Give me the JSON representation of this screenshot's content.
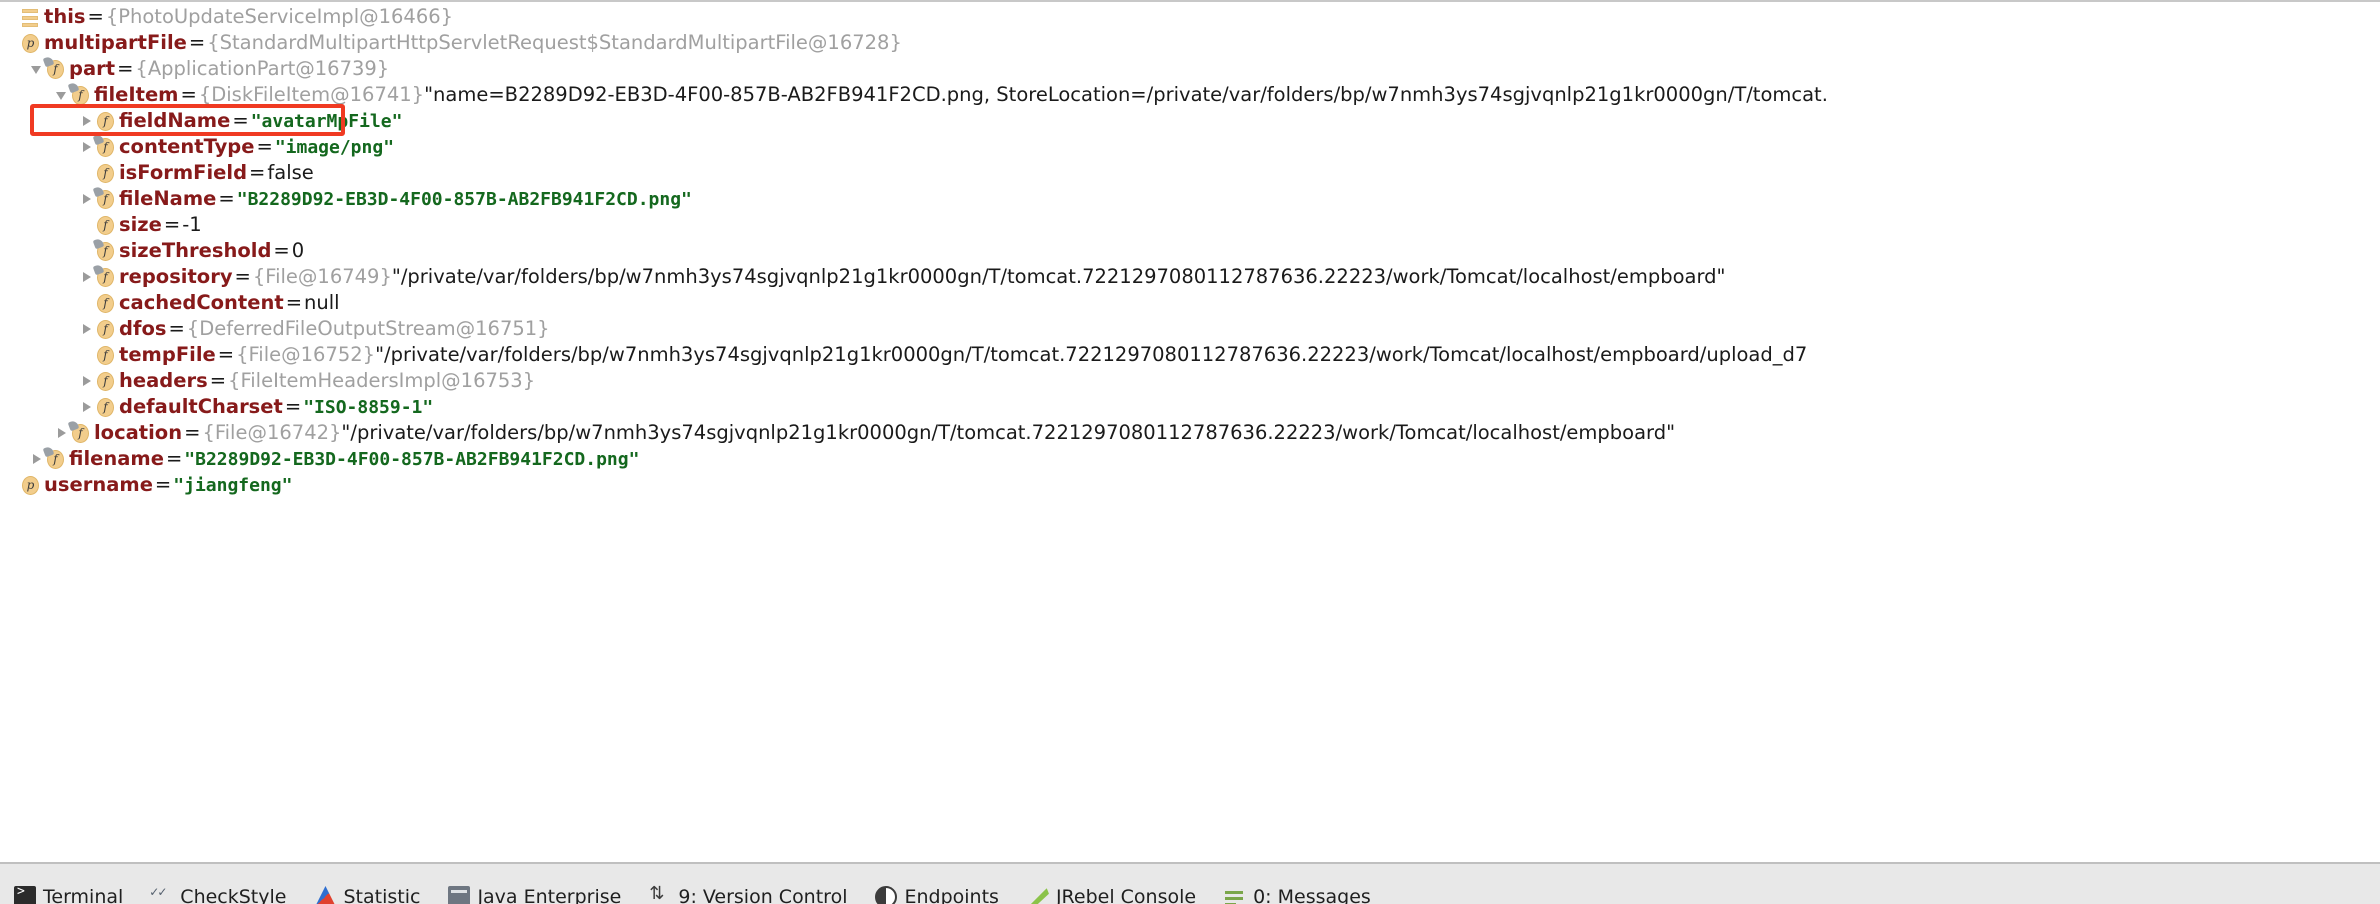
{
  "panel": {
    "name": "debugger-variables-panel"
  },
  "variables": [
    {
      "indent": 0,
      "twisty": "none",
      "icon": "this-icon",
      "icon_kind": "bars",
      "static": false,
      "name": "this",
      "eq": "=",
      "ref": "{PhotoUpdateServiceImpl@16466}",
      "value": "",
      "value_kind": "none",
      "extra": ""
    },
    {
      "indent": 0,
      "twisty": "none",
      "icon": "parameter-icon",
      "icon_kind": "p",
      "static": false,
      "name": "multipartFile",
      "eq": "=",
      "ref": "{StandardMultipartHttpServletRequest$StandardMultipartFile@16728}",
      "value": "",
      "value_kind": "none",
      "extra": ""
    },
    {
      "indent": 1,
      "twisty": "expanded",
      "icon": "field-icon",
      "icon_kind": "f",
      "static": true,
      "name": "part",
      "eq": "=",
      "ref": "{ApplicationPart@16739}",
      "value": "",
      "value_kind": "none",
      "extra": ""
    },
    {
      "indent": 2,
      "twisty": "expanded",
      "icon": "field-icon",
      "icon_kind": "f",
      "static": true,
      "name": "fileItem",
      "eq": "=",
      "ref": "{DiskFileItem@16741}",
      "value": "",
      "value_kind": "none",
      "extra": "\"name=B2289D92-EB3D-4F00-857B-AB2FB941F2CD.png, StoreLocation=/private/var/folders/bp/w7nmh3ys74sgjvqnlp21g1kr0000gn/T/tomcat."
    },
    {
      "indent": 3,
      "twisty": "collapsed",
      "icon": "field-icon",
      "icon_kind": "f",
      "static": false,
      "name": "fieldName",
      "eq": "=",
      "ref": "",
      "value": "\"avatarMpFile\"",
      "value_kind": "string",
      "extra": ""
    },
    {
      "indent": 3,
      "twisty": "collapsed",
      "icon": "field-icon",
      "icon_kind": "f",
      "static": true,
      "name": "contentType",
      "eq": "=",
      "ref": "",
      "value": "\"image/png\"",
      "value_kind": "string",
      "extra": ""
    },
    {
      "indent": 3,
      "twisty": "none",
      "icon": "field-icon",
      "icon_kind": "f",
      "static": false,
      "name": "isFormField",
      "eq": "=",
      "ref": "",
      "value": "false",
      "value_kind": "literal",
      "extra": ""
    },
    {
      "indent": 3,
      "twisty": "collapsed",
      "icon": "field-icon",
      "icon_kind": "f",
      "static": true,
      "name": "fileName",
      "eq": "=",
      "ref": "",
      "value": "\"B2289D92-EB3D-4F00-857B-AB2FB941F2CD.png\"",
      "value_kind": "string",
      "extra": ""
    },
    {
      "indent": 3,
      "twisty": "none",
      "icon": "field-icon",
      "icon_kind": "f",
      "static": false,
      "name": "size",
      "eq": "=",
      "ref": "",
      "value": "-1",
      "value_kind": "literal",
      "extra": ""
    },
    {
      "indent": 3,
      "twisty": "none",
      "icon": "field-icon",
      "icon_kind": "f",
      "static": true,
      "name": "sizeThreshold",
      "eq": "=",
      "ref": "",
      "value": "0",
      "value_kind": "literal",
      "extra": ""
    },
    {
      "indent": 3,
      "twisty": "collapsed",
      "icon": "field-icon",
      "icon_kind": "f",
      "static": true,
      "name": "repository",
      "eq": "=",
      "ref": "{File@16749}",
      "value": "",
      "value_kind": "none",
      "extra": "\"/private/var/folders/bp/w7nmh3ys74sgjvqnlp21g1kr0000gn/T/tomcat.7221297080112787636.22223/work/Tomcat/localhost/empboard\""
    },
    {
      "indent": 3,
      "twisty": "none",
      "icon": "field-icon",
      "icon_kind": "f",
      "static": false,
      "name": "cachedContent",
      "eq": "=",
      "ref": "",
      "value": "null",
      "value_kind": "literal",
      "extra": ""
    },
    {
      "indent": 3,
      "twisty": "collapsed",
      "icon": "field-icon",
      "icon_kind": "f",
      "static": false,
      "name": "dfos",
      "eq": "=",
      "ref": "{DeferredFileOutputStream@16751}",
      "value": "",
      "value_kind": "none",
      "extra": ""
    },
    {
      "indent": 3,
      "twisty": "none",
      "icon": "field-icon",
      "icon_kind": "f",
      "static": false,
      "name": "tempFile",
      "eq": "=",
      "ref": "{File@16752}",
      "value": "",
      "value_kind": "none",
      "extra": "\"/private/var/folders/bp/w7nmh3ys74sgjvqnlp21g1kr0000gn/T/tomcat.7221297080112787636.22223/work/Tomcat/localhost/empboard/upload_d7"
    },
    {
      "indent": 3,
      "twisty": "collapsed",
      "icon": "field-icon",
      "icon_kind": "f",
      "static": false,
      "name": "headers",
      "eq": "=",
      "ref": "{FileItemHeadersImpl@16753}",
      "value": "",
      "value_kind": "none",
      "extra": ""
    },
    {
      "indent": 3,
      "twisty": "collapsed",
      "icon": "field-icon",
      "icon_kind": "f",
      "static": false,
      "name": "defaultCharset",
      "eq": "=",
      "ref": "",
      "value": "\"ISO-8859-1\"",
      "value_kind": "string",
      "extra": ""
    },
    {
      "indent": 2,
      "twisty": "collapsed",
      "icon": "field-icon",
      "icon_kind": "f",
      "static": true,
      "name": "location",
      "eq": "=",
      "ref": "{File@16742}",
      "value": "",
      "value_kind": "none",
      "extra": "\"/private/var/folders/bp/w7nmh3ys74sgjvqnlp21g1kr0000gn/T/tomcat.7221297080112787636.22223/work/Tomcat/localhost/empboard\""
    },
    {
      "indent": 1,
      "twisty": "collapsed",
      "icon": "field-icon",
      "icon_kind": "f",
      "static": true,
      "name": "filename",
      "eq": "=",
      "ref": "",
      "value": "\"B2289D92-EB3D-4F00-857B-AB2FB941F2CD.png\"",
      "value_kind": "string",
      "extra": ""
    },
    {
      "indent": 0,
      "twisty": "none",
      "icon": "parameter-icon",
      "icon_kind": "p",
      "static": false,
      "name": "username",
      "eq": "=",
      "ref": "",
      "value": "\"jiangfeng\"",
      "value_kind": "string",
      "extra": ""
    }
  ],
  "annotation": {
    "name": "fieldname-highlight-box",
    "color": "#f03a22"
  },
  "bottom_bar": {
    "tabs": [
      {
        "label": "Terminal",
        "icon": "terminal-icon",
        "icon_class": "ico-terminal"
      },
      {
        "label": "CheckStyle",
        "icon": "checkstyle-icon",
        "icon_class": "ico-checkstyle"
      },
      {
        "label": "Statistic",
        "icon": "statistic-icon",
        "icon_class": "ico-statistic"
      },
      {
        "label": "Java Enterprise",
        "icon": "java-enterprise-icon",
        "icon_class": "ico-javaee"
      },
      {
        "label": "9: Version Control",
        "icon": "version-control-icon",
        "icon_class": "ico-vcs"
      },
      {
        "label": "Endpoints",
        "icon": "endpoints-icon",
        "icon_class": "ico-endpoints"
      },
      {
        "label": "JRebel Console",
        "icon": "jrebel-icon",
        "icon_class": "ico-jrebel"
      },
      {
        "label": "0: Messages",
        "icon": "messages-icon",
        "icon_class": "ico-messages"
      }
    ]
  }
}
